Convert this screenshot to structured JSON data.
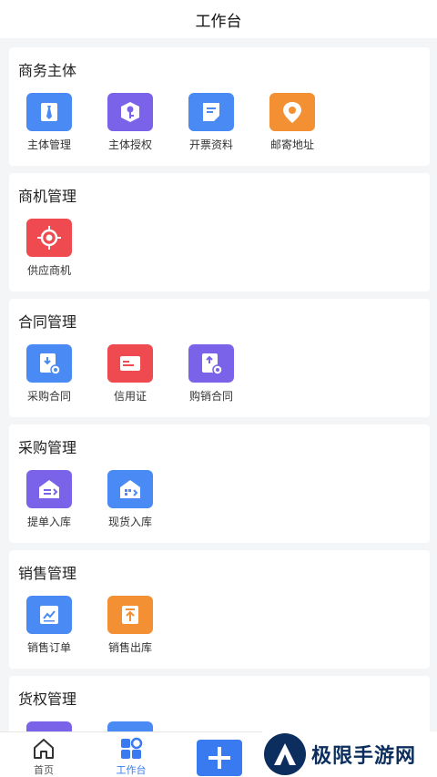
{
  "header": {
    "title": "工作台"
  },
  "colors": {
    "accent": "#3a7af0",
    "blue": "#4a8af4",
    "purple": "#7a63e8",
    "orange": "#f39033",
    "red": "#ef4a50"
  },
  "sections": [
    {
      "title": "商务主体",
      "items": [
        {
          "label": "主体管理",
          "icon": "tie-icon",
          "color": "blue"
        },
        {
          "label": "主体授权",
          "icon": "key-icon",
          "color": "purple"
        },
        {
          "label": "开票资料",
          "icon": "document-icon",
          "color": "blue"
        },
        {
          "label": "邮寄地址",
          "icon": "location-pin-icon",
          "color": "orange"
        }
      ]
    },
    {
      "title": "商机管理",
      "items": [
        {
          "label": "供应商机",
          "icon": "target-icon",
          "color": "red"
        }
      ]
    },
    {
      "title": "合同管理",
      "items": [
        {
          "label": "采购合同",
          "icon": "purchase-contract-icon",
          "color": "blue"
        },
        {
          "label": "信用证",
          "icon": "card-icon",
          "color": "red"
        },
        {
          "label": "购销合同",
          "icon": "sales-contract-icon",
          "color": "purple"
        }
      ]
    },
    {
      "title": "采购管理",
      "items": [
        {
          "label": "提单入库",
          "icon": "warehouse-in-icon",
          "color": "purple"
        },
        {
          "label": "现货入库",
          "icon": "warehouse-stock-icon",
          "color": "blue"
        }
      ]
    },
    {
      "title": "销售管理",
      "items": [
        {
          "label": "销售订单",
          "icon": "chart-icon",
          "color": "blue"
        },
        {
          "label": "销售出库",
          "icon": "box-out-icon",
          "color": "orange"
        }
      ]
    },
    {
      "title": "货权管理",
      "items": [
        {
          "label": "",
          "icon": "warehouse-in-icon",
          "color": "purple"
        },
        {
          "label": "",
          "icon": "warehouse-stock-icon",
          "color": "blue"
        }
      ]
    }
  ],
  "tabbar": {
    "home_label": "首页",
    "workbench_label": "工作台"
  },
  "watermark": {
    "text": "极限手游网"
  }
}
